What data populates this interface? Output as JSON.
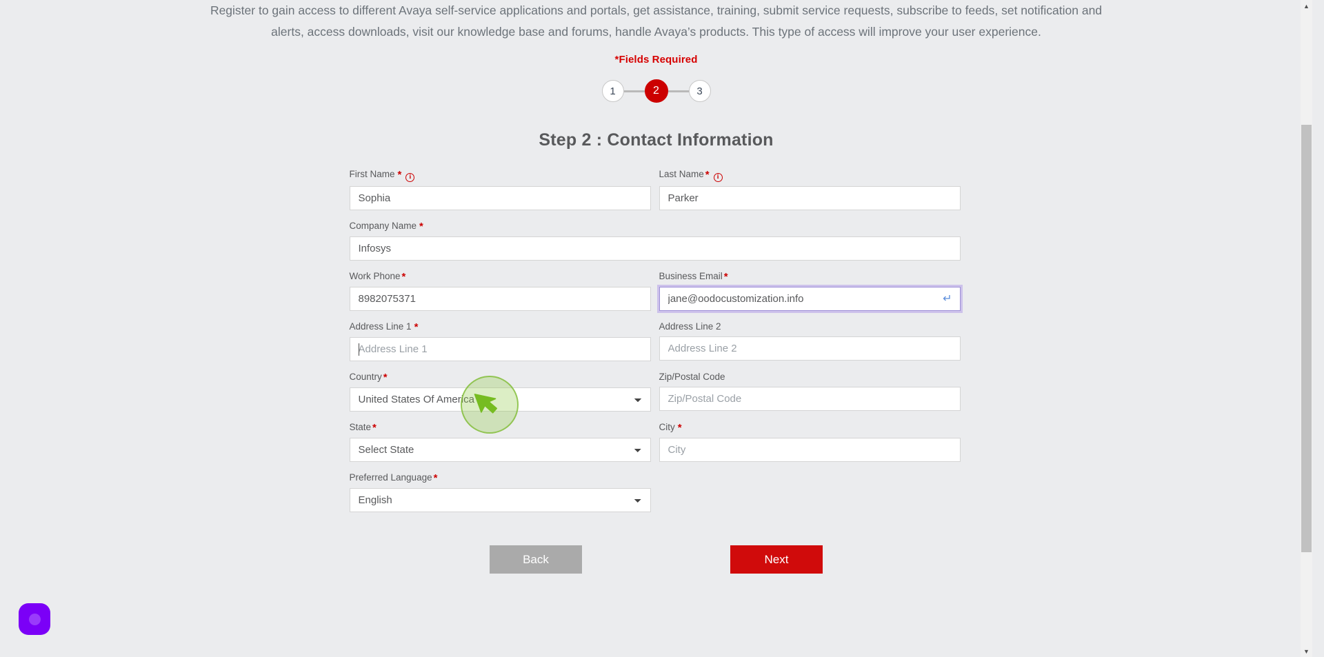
{
  "intro": {
    "line1": "Register to gain access to different Avaya self-service applications and portals, get assistance, training, submit service requests, subscribe to feeds, set notification and",
    "line2": "alerts, access downloads, visit our knowledge base and forums, handle Avaya’s products. This type of access will improve your user experience.",
    "fields_required": "*Fields Required"
  },
  "stepper": {
    "step1": "1",
    "step2": "2",
    "step3": "3",
    "active": "2",
    "active_color": "#cc0000"
  },
  "step_title": "Step 2 : Contact Information",
  "form": {
    "first_name": {
      "label": "First Name",
      "required": true,
      "has_info": true,
      "value": "Sophia",
      "placeholder": "First Name"
    },
    "last_name": {
      "label": "Last Name",
      "required": true,
      "has_info": true,
      "value": "Parker",
      "placeholder": "Last Name"
    },
    "company_name": {
      "label": "Company Name",
      "required": true,
      "value": "Infosys",
      "placeholder": "Company Name"
    },
    "work_phone": {
      "label": "Work Phone",
      "required": true,
      "value": "8982075371",
      "placeholder": "Work Phone"
    },
    "business_email": {
      "label": "Business Email",
      "required": true,
      "value": "jane@oodocustomization.info",
      "placeholder": "Business Email",
      "focused": true,
      "action_icon": "enter-return-icon",
      "action_glyph": "↵",
      "focus_border_color": "#9d8fd6"
    },
    "address_line_1": {
      "label": "Address Line 1",
      "required": true,
      "value": "",
      "placeholder": "Address Line 1"
    },
    "address_line_2": {
      "label": "Address Line 2",
      "required": false,
      "value": "",
      "placeholder": "Address Line 2"
    },
    "country": {
      "label": "Country",
      "required": true,
      "value": "United States Of America",
      "options": [
        "United States Of America"
      ]
    },
    "zip": {
      "label": "Zip/Postal Code",
      "required": false,
      "value": "",
      "placeholder": "Zip/Postal Code"
    },
    "state": {
      "label": "State",
      "required": true,
      "value": "Select State",
      "options": [
        "Select State"
      ]
    },
    "city": {
      "label": "City",
      "required": true,
      "value": "",
      "placeholder": "City"
    },
    "preferred_language": {
      "label": "Preferred Language",
      "required": true,
      "value": "English",
      "options": [
        "English"
      ]
    }
  },
  "buttons": {
    "back": "Back",
    "next": "Next",
    "back_color": "#aaaaaa",
    "next_color": "#d00b0b"
  },
  "annotation": {
    "cursor_icon": "mouse-cursor-arrow-icon",
    "highlight_color": "#8cc63f"
  },
  "widget": {
    "icon": "chat-widget-icon",
    "color": "#7b00f7"
  },
  "scrollbar": {
    "up_glyph": "▲",
    "down_glyph": "▼"
  }
}
